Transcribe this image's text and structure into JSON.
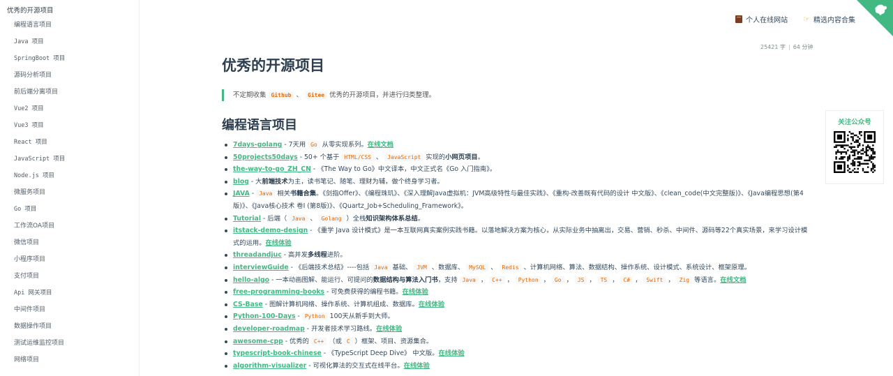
{
  "sidebar": {
    "top_item": "优秀的开源项目",
    "items": [
      "编程语言项目",
      "Java 项目",
      "SpringBoot 项目",
      "源码分析项目",
      "前后端分离项目",
      "Vue2 项目",
      "Vue3 项目",
      "React 项目",
      "JavaScript 项目",
      "Node.js 项目",
      "微服务项目",
      "Go 项目",
      "工作流OA项目",
      "微信项目",
      "小程序项目",
      "支付项目",
      "Api 网关项目",
      "中间件项目",
      "数据操作项目",
      "测试运维监控项目",
      "网络项目"
    ]
  },
  "topnav": {
    "site": "个人在线网站",
    "featured": "精选内容合集"
  },
  "wordcount": {
    "words": "25421 字",
    "minutes": "64 分钟"
  },
  "page": {
    "title": "优秀的开源项目",
    "quote_before": "不定期收集",
    "quote_code1": "Github",
    "quote_sep": "、",
    "quote_code2": "Gitee",
    "quote_after": "优秀的开源项目，并进行归类整理。",
    "section_title": "编程语言项目"
  },
  "qr": {
    "title": "关注公众号"
  },
  "items": [
    {
      "segments": [
        {
          "t": "title",
          "v": "7days-golang"
        },
        {
          "t": "text",
          "v": " - 7天用 "
        },
        {
          "t": "code",
          "v": "Go"
        },
        {
          "t": "text",
          "v": " 从零实现系列。"
        },
        {
          "t": "link",
          "v": "在线文档"
        }
      ]
    },
    {
      "segments": [
        {
          "t": "title",
          "v": "50projects50days"
        },
        {
          "t": "text",
          "v": " - 50+ 个基于 "
        },
        {
          "t": "code",
          "v": "HTML/CSS"
        },
        {
          "t": "text",
          "v": " 、 "
        },
        {
          "t": "code",
          "v": "JavaScript"
        },
        {
          "t": "text",
          "v": " 实现的"
        },
        {
          "t": "bold",
          "v": "小网页项目"
        },
        {
          "t": "text",
          "v": "。"
        }
      ]
    },
    {
      "segments": [
        {
          "t": "title",
          "v": "the-way-to-go_ZH_CN"
        },
        {
          "t": "text",
          "v": " - 《The Way to Go》中文译本，中文正式名《Go 入门指南》。"
        }
      ]
    },
    {
      "segments": [
        {
          "t": "title",
          "v": "blog"
        },
        {
          "t": "text",
          "v": " - 大"
        },
        {
          "t": "bold",
          "v": "前端技术"
        },
        {
          "t": "text",
          "v": "为主，读书笔记、随笔、理财为辅，做个终身学习者。"
        }
      ]
    },
    {
      "segments": [
        {
          "t": "title",
          "v": "JAVA"
        },
        {
          "t": "text",
          "v": " - "
        },
        {
          "t": "code",
          "v": "Java"
        },
        {
          "t": "text",
          "v": " 相关"
        },
        {
          "t": "bold",
          "v": "书籍合集"
        },
        {
          "t": "text",
          "v": "。《剑指Offer》、《编程珠玑》、《深入理解Java虚拟机：JVM高级特性与最佳实践》、《重构-改善既有代码的设计 中文版》、《clean_code(中文完整版)》、《Java编程思想(第4版)》、《Java核心技术 卷I (第8版)》、《Quartz_Job+Scheduling_Framework》。"
        }
      ]
    },
    {
      "segments": [
        {
          "t": "title",
          "v": "Tutorial"
        },
        {
          "t": "text",
          "v": " - 后端（ "
        },
        {
          "t": "code",
          "v": "Java"
        },
        {
          "t": "text",
          "v": " 、 "
        },
        {
          "t": "code",
          "v": "Golang"
        },
        {
          "t": "text",
          "v": " ）全栈"
        },
        {
          "t": "bold",
          "v": "知识架构体系总结"
        },
        {
          "t": "text",
          "v": "。"
        }
      ]
    },
    {
      "segments": [
        {
          "t": "title",
          "v": "itstack-demo-design"
        },
        {
          "t": "text",
          "v": " - 《重学 Java 设计模式》是一本互联网真实案例实践书籍。以落地解决方案为核心，从实际业务中抽离出，交易、营销、秒杀、中间件、源码等22个真实场景，来学习设计模式的运用。"
        },
        {
          "t": "link",
          "v": "在线体验"
        }
      ]
    },
    {
      "segments": [
        {
          "t": "title",
          "v": "threadandjuc"
        },
        {
          "t": "text",
          "v": " - 高并发"
        },
        {
          "t": "bold",
          "v": "多线程"
        },
        {
          "t": "text",
          "v": "进阶。"
        }
      ]
    },
    {
      "segments": [
        {
          "t": "title",
          "v": "interviewGuide"
        },
        {
          "t": "text",
          "v": " - 《后端技术总结》----包括 "
        },
        {
          "t": "code",
          "v": "Java"
        },
        {
          "t": "text",
          "v": " 基础、 "
        },
        {
          "t": "code",
          "v": "JVM"
        },
        {
          "t": "text",
          "v": " 、数据库、 "
        },
        {
          "t": "code",
          "v": "MySQL"
        },
        {
          "t": "text",
          "v": " 、 "
        },
        {
          "t": "code",
          "v": "Redis"
        },
        {
          "t": "text",
          "v": " 、计算机网络、算法、数据结构、操作系统、设计模式、系统设计、框架原理。"
        }
      ]
    },
    {
      "segments": [
        {
          "t": "title",
          "v": "hello-algo"
        },
        {
          "t": "text",
          "v": " - 一本动画图解、能运行、可提问的"
        },
        {
          "t": "bold",
          "v": "数据结构与算法入门书"
        },
        {
          "t": "text",
          "v": "，支持 "
        },
        {
          "t": "code",
          "v": "Java"
        },
        {
          "t": "text",
          "v": " ， "
        },
        {
          "t": "code",
          "v": "C++"
        },
        {
          "t": "text",
          "v": " ， "
        },
        {
          "t": "code",
          "v": "Python"
        },
        {
          "t": "text",
          "v": " ， "
        },
        {
          "t": "code",
          "v": "Go"
        },
        {
          "t": "text",
          "v": " ， "
        },
        {
          "t": "code",
          "v": "JS"
        },
        {
          "t": "text",
          "v": " ， "
        },
        {
          "t": "code",
          "v": "TS"
        },
        {
          "t": "text",
          "v": " ， "
        },
        {
          "t": "code",
          "v": "C#"
        },
        {
          "t": "text",
          "v": " ， "
        },
        {
          "t": "code",
          "v": "Swift"
        },
        {
          "t": "text",
          "v": " ， "
        },
        {
          "t": "code",
          "v": "Zig"
        },
        {
          "t": "text",
          "v": " 等语言。"
        },
        {
          "t": "link",
          "v": "在线文档"
        }
      ]
    },
    {
      "segments": [
        {
          "t": "title",
          "v": "free-programming-books"
        },
        {
          "t": "text",
          "v": " - 可免费获得的编程书籍。"
        },
        {
          "t": "link",
          "v": "在线体验"
        }
      ]
    },
    {
      "segments": [
        {
          "t": "title",
          "v": "CS-Base"
        },
        {
          "t": "text",
          "v": " - 图解计算机网络、操作系统、计算机组成、数据库。"
        },
        {
          "t": "link",
          "v": "在线体验"
        }
      ]
    },
    {
      "segments": [
        {
          "t": "title",
          "v": "Python-100-Days"
        },
        {
          "t": "text",
          "v": " - "
        },
        {
          "t": "code",
          "v": "Python"
        },
        {
          "t": "text",
          "v": " 100天从新手到大师。"
        }
      ]
    },
    {
      "segments": [
        {
          "t": "title",
          "v": "developer-roadmap"
        },
        {
          "t": "text",
          "v": " - 开发者技术学习路线。"
        },
        {
          "t": "link",
          "v": "在线体验"
        }
      ]
    },
    {
      "segments": [
        {
          "t": "title",
          "v": "awesome-cpp"
        },
        {
          "t": "text",
          "v": " - 优秀的 "
        },
        {
          "t": "code",
          "v": "C++"
        },
        {
          "t": "text",
          "v": " （或 "
        },
        {
          "t": "code",
          "v": "C"
        },
        {
          "t": "text",
          "v": " ）框架、项目、资源集合。"
        }
      ]
    },
    {
      "segments": [
        {
          "t": "title",
          "v": "typescript-book-chinese"
        },
        {
          "t": "text",
          "v": " - 《TypeScript Deep Dive》 中文版。"
        },
        {
          "t": "link",
          "v": "在线体验"
        }
      ]
    },
    {
      "segments": [
        {
          "t": "title",
          "v": "algorithm-visualizer"
        },
        {
          "t": "text",
          "v": " - 可视化算法的交互式在线平台。"
        },
        {
          "t": "link",
          "v": "在线体验"
        }
      ]
    }
  ],
  "colors": {
    "accent": "#42b983",
    "code": "#e96900",
    "text": "#34495e"
  }
}
